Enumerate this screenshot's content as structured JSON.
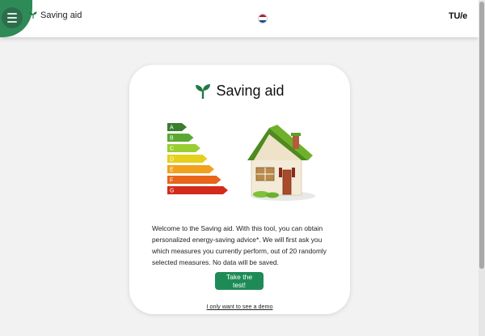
{
  "header": {
    "brand_label": "Saving aid",
    "logo_text": "TU/e",
    "language_flag": "netherlands-flag",
    "accent_color": "#2e8b57"
  },
  "card": {
    "title": "Saving aid",
    "energy_labels": [
      "A",
      "B",
      "C",
      "D",
      "E",
      "F",
      "G"
    ],
    "energy_label_colors": [
      "#3a7d2c",
      "#5aa732",
      "#9acd32",
      "#e5d01c",
      "#f0a21c",
      "#e8651a",
      "#d42a1a"
    ],
    "welcome_text": "Welcome to the Saving aid. With this tool, you can obtain personalized energy-saving advice*. We will first ask you which measures you currently perform, out of 20 randomly selected measures. No data will be saved.",
    "cta_label": "Take the test!",
    "demo_link_label": "I only want to see a demo"
  }
}
